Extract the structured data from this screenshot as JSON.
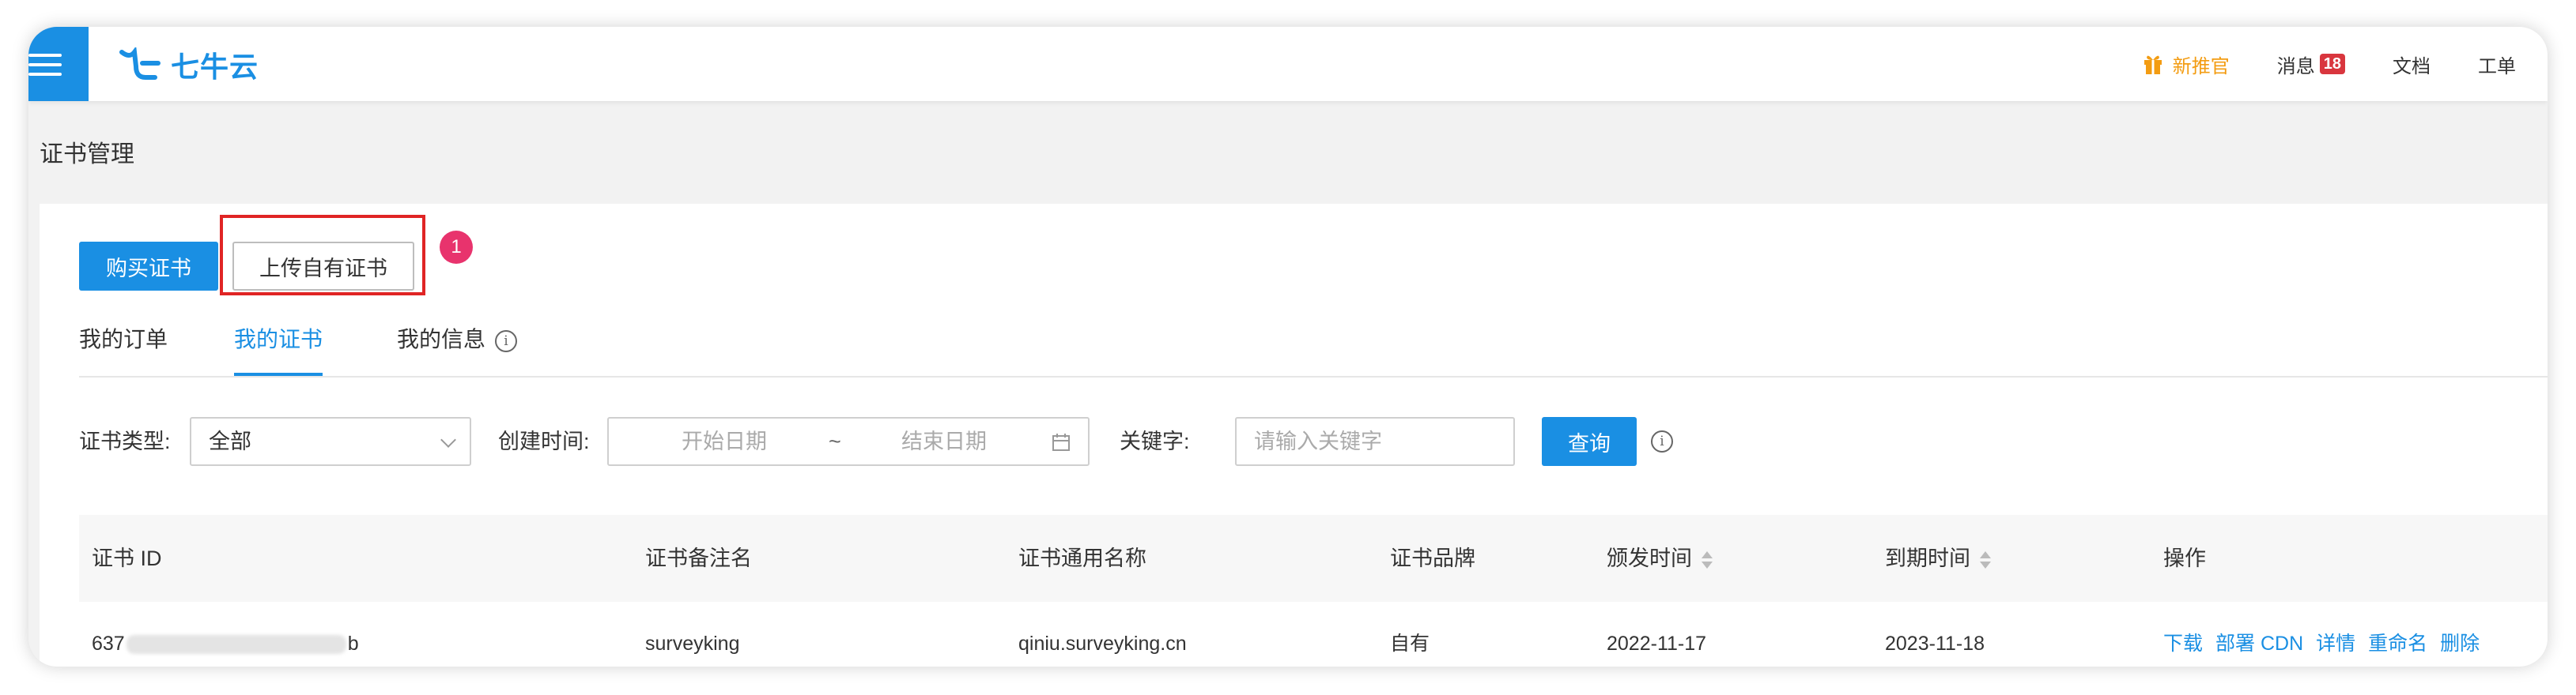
{
  "topbar": {
    "logo_text": "七牛云",
    "promo_label": "新推官",
    "messages_label": "消息",
    "messages_count": "18",
    "docs_label": "文档",
    "ticket_label": "工单"
  },
  "page": {
    "title": "证书管理"
  },
  "toolbar": {
    "buy_label": "购买证书",
    "upload_label": "上传自有证书",
    "step_marker": "1"
  },
  "tabs": [
    {
      "label": "我的订单",
      "active": false
    },
    {
      "label": "我的证书",
      "active": true
    },
    {
      "label": "我的信息",
      "active": false
    }
  ],
  "filters": {
    "type_label": "证书类型:",
    "type_value": "全部",
    "created_label": "创建时间:",
    "start_placeholder": "开始日期",
    "range_separator": "~",
    "end_placeholder": "结束日期",
    "keyword_label": "关键字:",
    "keyword_placeholder": "请输入关键字",
    "query_label": "查询"
  },
  "table": {
    "columns": [
      "证书 ID",
      "证书备注名",
      "证书通用名称",
      "证书品牌",
      "颁发时间",
      "到期时间",
      "操作"
    ],
    "rows": [
      {
        "id_prefix": "637",
        "id_suffix": "b",
        "note": "surveyking",
        "common_name": "qiniu.surveyking.cn",
        "brand": "自有",
        "issued": "2022-11-17",
        "expires": "2023-11-18",
        "actions": [
          "下载",
          "部署 CDN",
          "详情",
          "重命名",
          "删除"
        ]
      }
    ]
  },
  "colors": {
    "brand_blue": "#1a8fe3",
    "highlight_red": "#e02424",
    "step_pink": "#e8336d",
    "promo_orange": "#f39c12",
    "badge_red": "#d9363e"
  }
}
